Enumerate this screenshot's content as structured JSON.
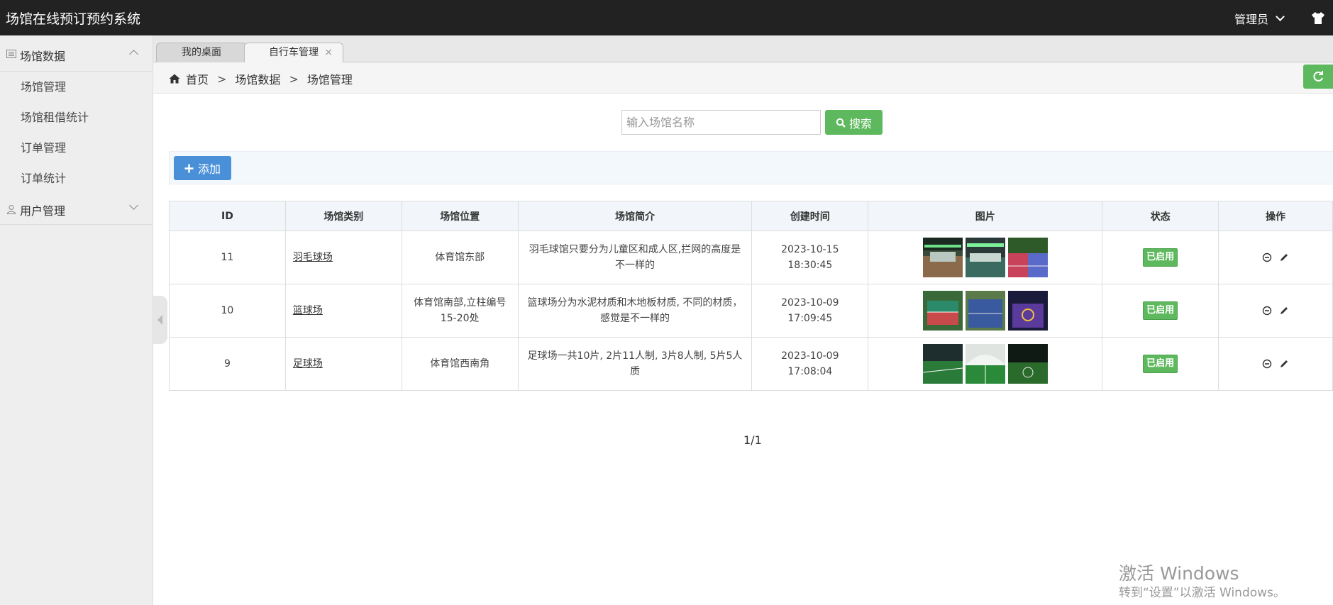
{
  "app": {
    "title": "场馆在线预订预约系统",
    "user": "管理员"
  },
  "sidebar": {
    "groups": [
      {
        "label": "场馆数据",
        "items": [
          "场馆管理",
          "场馆租借统计",
          "订单管理",
          "订单统计"
        ]
      },
      {
        "label": "用户管理"
      }
    ]
  },
  "tabs": [
    {
      "label": "我的桌面"
    },
    {
      "label": "自行车管理",
      "close": "×"
    }
  ],
  "breadcrumb": {
    "home": "首页",
    "sep": ">",
    "level1": "场馆数据",
    "level2": "场馆管理"
  },
  "search": {
    "placeholder": "输入场馆名称",
    "button": "搜索"
  },
  "toolbar": {
    "add": "添加"
  },
  "table": {
    "headers": [
      "ID",
      "场馆类别",
      "场馆位置",
      "场馆简介",
      "创建时间",
      "图片",
      "状态",
      "操作"
    ],
    "rows": [
      {
        "id": "11",
        "category": "羽毛球场",
        "location": "体育馆东部",
        "intro": "羽毛球馆只要分为儿童区和成人区,拦网的高度是不一样的",
        "created": "2023-10-15 18:30:45",
        "status": "已启用"
      },
      {
        "id": "10",
        "category": "篮球场",
        "location": "体育馆南部,立柱编号15-20处",
        "intro": "篮球场分为水泥材质和木地板材质, 不同的材质，感觉是不一样的",
        "created": "2023-10-09 17:09:45",
        "status": "已启用"
      },
      {
        "id": "9",
        "category": "足球场",
        "location": "体育馆西南角",
        "intro": "足球场一共10片, 2片11人制, 3片8人制, 5片5人质",
        "created": "2023-10-09 17:08:04",
        "status": "已启用"
      }
    ]
  },
  "pager": {
    "text": "1/1"
  },
  "watermark": {
    "line1": "激活 Windows",
    "line2": "转到“设置”以激活 Windows。"
  },
  "colors": {
    "topbar": "#222222",
    "green": "#5eb95e",
    "blue": "#4a90d9",
    "sidebar": "#eeeeee"
  }
}
